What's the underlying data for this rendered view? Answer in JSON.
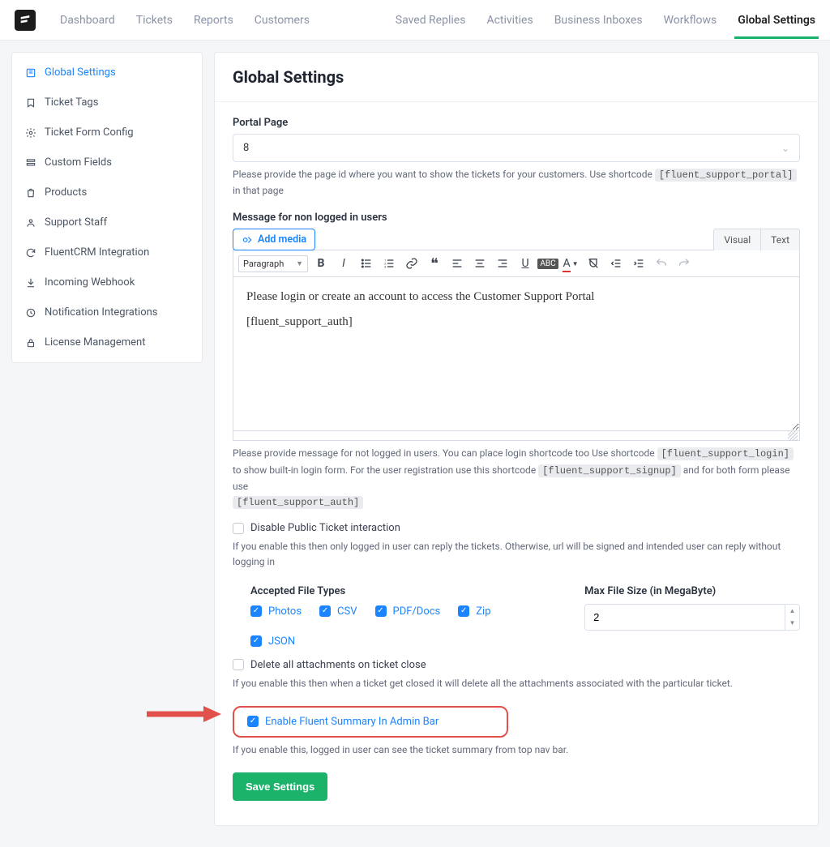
{
  "topnav": {
    "left": [
      "Dashboard",
      "Tickets",
      "Reports",
      "Customers"
    ],
    "right": [
      "Saved Replies",
      "Activities",
      "Business Inboxes",
      "Workflows",
      "Global Settings"
    ],
    "active": "Global Settings"
  },
  "sidebar": {
    "items": [
      {
        "label": "Global Settings"
      },
      {
        "label": "Ticket Tags"
      },
      {
        "label": "Ticket Form Config"
      },
      {
        "label": "Custom Fields"
      },
      {
        "label": "Products"
      },
      {
        "label": "Support Staff"
      },
      {
        "label": "FluentCRM Integration"
      },
      {
        "label": "Incoming Webhook"
      },
      {
        "label": "Notification Integrations"
      },
      {
        "label": "License Management"
      }
    ]
  },
  "header": {
    "title": "Global Settings"
  },
  "portal": {
    "label": "Portal Page",
    "value": "8",
    "help_before": "Please provide the page id where you want to show the tickets for your customers. Use shortcode ",
    "shortcode": "[fluent_support_portal]",
    "help_after": " in that page"
  },
  "editor": {
    "label": "Message for non logged in users",
    "add_media_label": "Add media",
    "tabs": [
      "Visual",
      "Text"
    ],
    "paragraph_label": "Paragraph",
    "content_line1": "Please login or create an account to access the Customer Support Portal",
    "content_line2": "[fluent_support_auth]",
    "help_1": "Please provide message for not logged in users. You can place login shortcode too Use shortcode ",
    "sc1": "[fluent_support_login]",
    "help_2": " to show built-in login form. For the user registration use this shortcode ",
    "sc2": "[fluent_support_signup]",
    "help_3": " and for both form please use ",
    "sc3": "[fluent_support_auth]"
  },
  "disable_public": {
    "label": "Disable Public Ticket interaction",
    "help": "If you enable this then only logged in user can reply the tickets. Otherwise, url will be signed and intended user can reply without logging in"
  },
  "files": {
    "title": "Accepted File Types",
    "types": [
      "Photos",
      "CSV",
      "PDF/Docs",
      "Zip",
      "JSON"
    ],
    "max_label": "Max File Size (in MegaByte)",
    "max_value": "2"
  },
  "delete_attach": {
    "label": "Delete all attachments on ticket close",
    "help": "If you enable this then when a ticket get closed it will delete all the attachments associated with the particular ticket."
  },
  "summary": {
    "label": "Enable Fluent Summary In Admin Bar",
    "help": "If you enable this, logged in user can see the ticket summary from top nav bar."
  },
  "save": {
    "label": "Save Settings"
  }
}
